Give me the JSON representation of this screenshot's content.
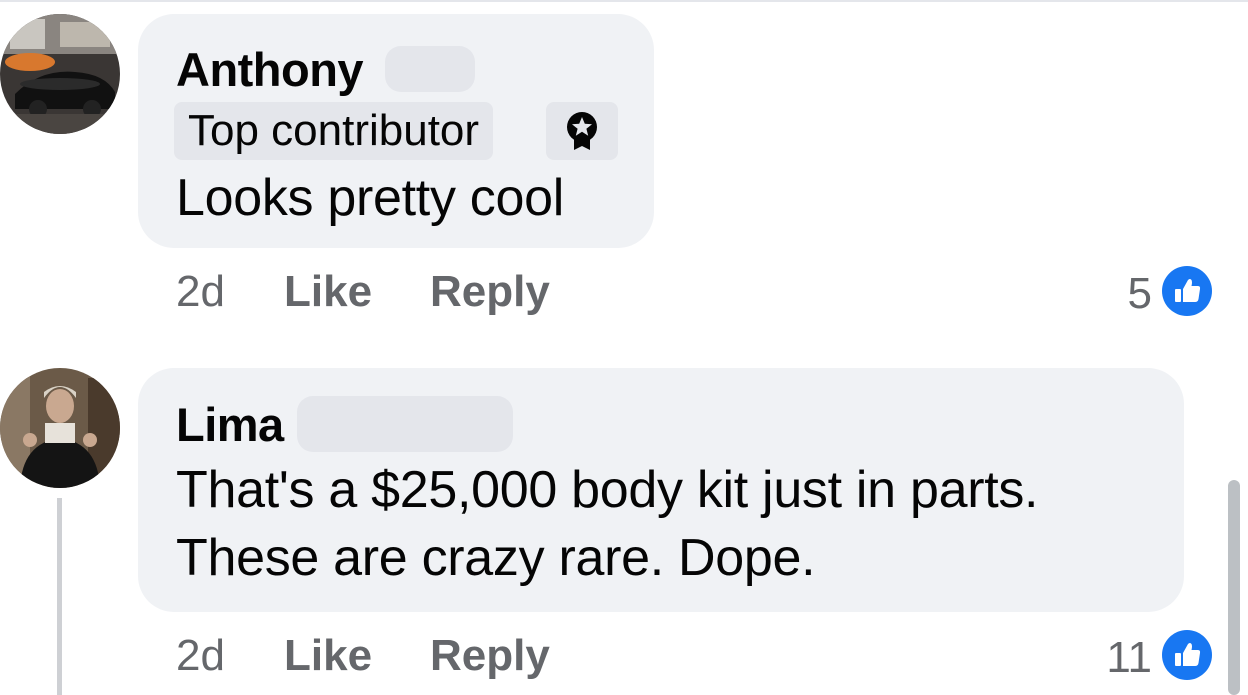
{
  "comments": [
    {
      "author": "Anthony",
      "badge": "Top contributor",
      "text_lines": [
        "Looks pretty cool"
      ],
      "age": "2d",
      "like_label": "Like",
      "reply_label": "Reply",
      "reaction_count": "5"
    },
    {
      "author": "Lima",
      "text_lines": [
        "That's a $25,000 body kit just in parts.",
        "These are crazy rare. Dope."
      ],
      "age": "2d",
      "like_label": "Like",
      "reply_label": "Reply",
      "reaction_count": "11"
    }
  ],
  "colors": {
    "bubble": "#f0f2f5",
    "meta_text": "#65676b",
    "like_blue": "#1877f2"
  },
  "icons": [
    "top-contributor-badge-icon",
    "thumbs-up-reaction-icon"
  ]
}
